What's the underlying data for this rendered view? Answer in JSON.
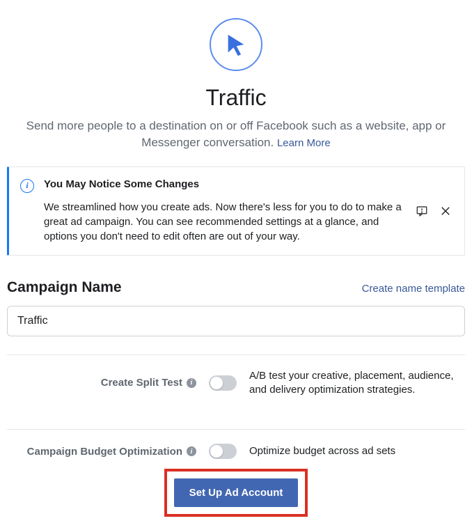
{
  "hero": {
    "title": "Traffic",
    "description": "Send more people to a destination on or off Facebook such as a website, app or Messenger conversation.",
    "learn_more": "Learn More"
  },
  "notice": {
    "title": "You May Notice Some Changes",
    "body": "We streamlined how you create ads. Now there's less for you to do to make a great ad campaign. You can see recommended settings at a glance, and options you don't need to edit often are out of your way."
  },
  "campaign": {
    "section_title": "Campaign Name",
    "template_link": "Create name template",
    "name_value": "Traffic"
  },
  "options": {
    "split_test": {
      "label": "Create Split Test",
      "desc": "A/B test your creative, placement, audience, and delivery optimization strategies."
    },
    "budget_opt": {
      "label": "Campaign Budget Optimization",
      "desc": "Optimize budget across ad sets"
    }
  },
  "cta": {
    "label": "Set Up Ad Account"
  }
}
